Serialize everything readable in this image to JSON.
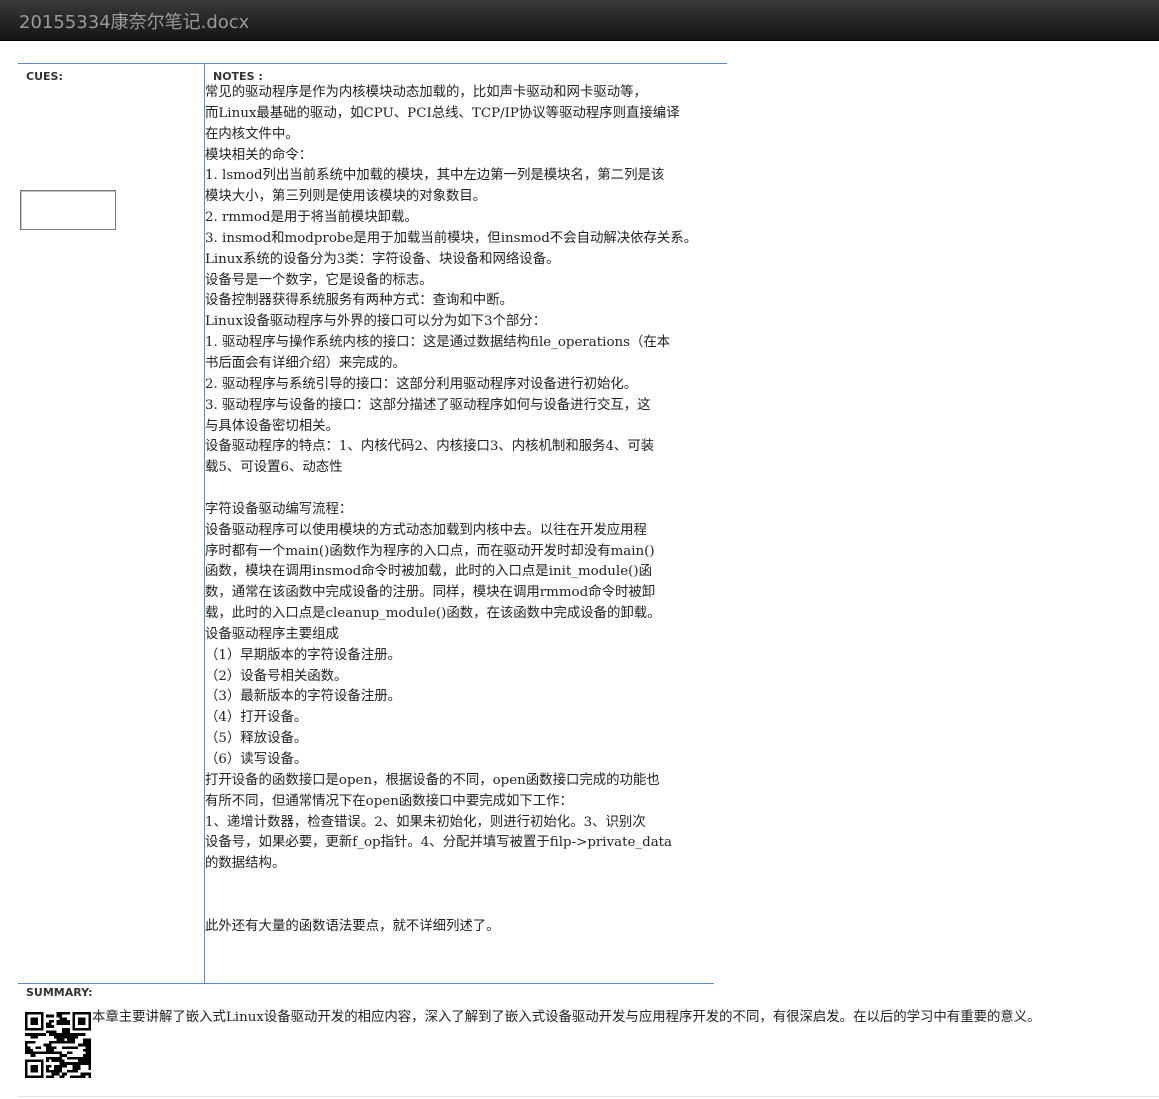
{
  "window": {
    "title": "20155334康奈尔笔记.docx"
  },
  "cornell": {
    "cues_label": "CUES:",
    "notes_label": "NOTES :",
    "summary_label": "SUMMARY:",
    "notes_lines": [
      "常见的驱动程序是作为内核模块动态加载的，比如声卡驱动和网卡驱动等，",
      "而Linux最基础的驱动，如CPU、PCI总线、TCP/IP协议等驱动程序则直接编译",
      "在内核文件中。",
      "模块相关的命令：",
      "1. lsmod列出当前系统中加载的模块，其中左边第一列是模块名，第二列是该",
      "模块大小，第三列则是使用该模块的对象数目。",
      "2. rmmod是用于将当前模块卸载。",
      "3. insmod和modprobe是用于加载当前模块，但insmod不会自动解决依存关系。",
      "Linux系统的设备分为3类：字符设备、块设备和网络设备。",
      "设备号是一个数字，它是设备的标志。",
      "设备控制器获得系统服务有两种方式：查询和中断。",
      "Linux设备驱动程序与外界的接口可以分为如下3个部分：",
      "1. 驱动程序与操作系统内核的接口：这是通过数据结构file_operations（在本",
      "书后面会有详细介绍）来完成的。",
      "2. 驱动程序与系统引导的接口：这部分利用驱动程序对设备进行初始化。",
      "3. 驱动程序与设备的接口：这部分描述了驱动程序如何与设备进行交互，这",
      "与具体设备密切相关。",
      "设备驱动程序的特点：1、内核代码2、内核接口3、内核机制和服务4、可装",
      "载5、可设置6、动态性",
      "",
      "字符设备驱动编写流程：",
      "设备驱动程序可以使用模块的方式动态加载到内核中去。以往在开发应用程",
      "序时都有一个main()函数作为程序的入口点，而在驱动开发时却没有main()",
      "函数，模块在调用insmod命令时被加载，此时的入口点是init_module()函",
      "数，通常在该函数中完成设备的注册。同样，模块在调用rmmod命令时被卸",
      "载，此时的入口点是cleanup_module()函数，在该函数中完成设备的卸载。",
      "设备驱动程序主要组成",
      "（1）早期版本的字符设备注册。",
      "（2）设备号相关函数。",
      "（3）最新版本的字符设备注册。",
      "（4）打开设备。",
      "（5）释放设备。",
      "（6）读写设备。",
      "打开设备的函数接口是open，根据设备的不同，open函数接口完成的功能也",
      "有所不同，但通常情况下在open函数接口中要完成如下工作：",
      "1、递增计数器，检查错误。2、如果未初始化，则进行初始化。3、识别次",
      "设备号，如果必要，更新f_op指针。4、分配并填写被置于filp->private_data",
      "的数据结构。",
      "",
      "",
      "此外还有大量的函数语法要点，就不详细列述了。"
    ],
    "summary_text": "本章主要讲解了嵌入式Linux设备驱动开发的相应内容，深入了解到了嵌入式设备驱动开发与应用程序开发的不同，有很深启发。在以后的学习中有重要的意义。"
  }
}
